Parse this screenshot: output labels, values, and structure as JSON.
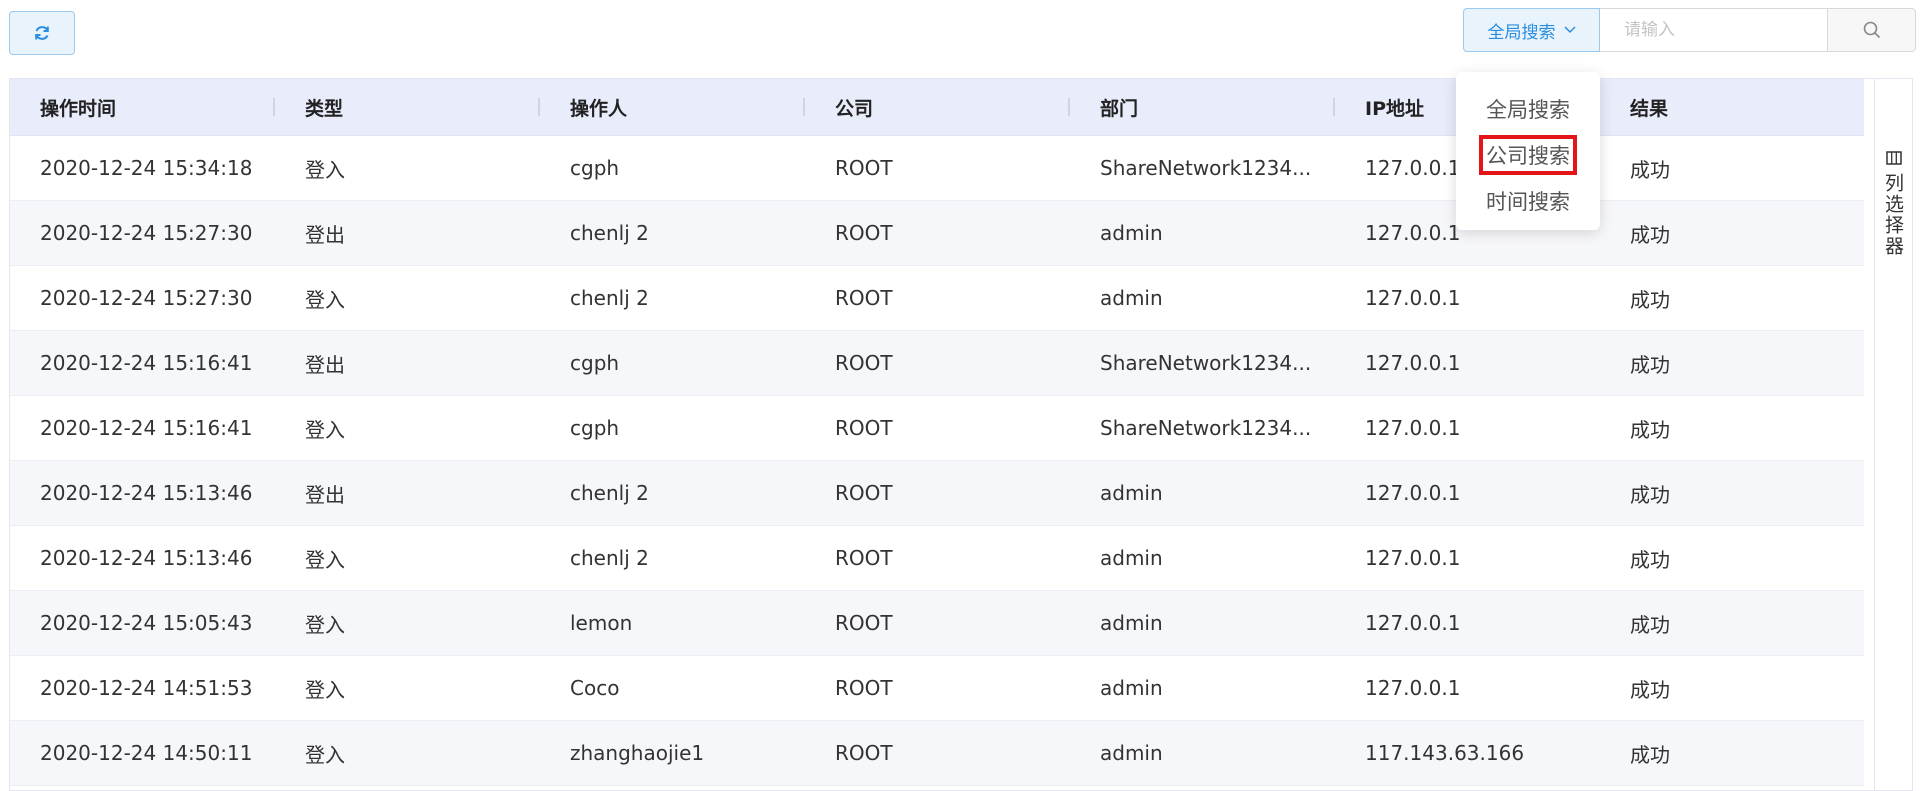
{
  "toolbar": {
    "scope_label": "全局搜索",
    "search_placeholder": "请输入"
  },
  "table": {
    "columns": [
      "操作时间",
      "类型",
      "操作人",
      "公司",
      "部门",
      "IP地址",
      "结果"
    ],
    "rows": [
      [
        "2020-12-24 15:34:18",
        "登入",
        "cgph",
        "ROOT",
        "ShareNetwork1234...",
        "127.0.0.1",
        "成功"
      ],
      [
        "2020-12-24 15:27:30",
        "登出",
        "chenlj 2",
        "ROOT",
        "admin",
        "127.0.0.1",
        "成功"
      ],
      [
        "2020-12-24 15:27:30",
        "登入",
        "chenlj 2",
        "ROOT",
        "admin",
        "127.0.0.1",
        "成功"
      ],
      [
        "2020-12-24 15:16:41",
        "登出",
        "cgph",
        "ROOT",
        "ShareNetwork1234...",
        "127.0.0.1",
        "成功"
      ],
      [
        "2020-12-24 15:16:41",
        "登入",
        "cgph",
        "ROOT",
        "ShareNetwork1234...",
        "127.0.0.1",
        "成功"
      ],
      [
        "2020-12-24 15:13:46",
        "登出",
        "chenlj 2",
        "ROOT",
        "admin",
        "127.0.0.1",
        "成功"
      ],
      [
        "2020-12-24 15:13:46",
        "登入",
        "chenlj 2",
        "ROOT",
        "admin",
        "127.0.0.1",
        "成功"
      ],
      [
        "2020-12-24 15:05:43",
        "登入",
        "lemon",
        "ROOT",
        "admin",
        "127.0.0.1",
        "成功"
      ],
      [
        "2020-12-24 14:51:53",
        "登入",
        "Coco",
        "ROOT",
        "admin",
        "127.0.0.1",
        "成功"
      ],
      [
        "2020-12-24 14:50:11",
        "登入",
        "zhanghaojie1",
        "ROOT",
        "admin",
        "117.143.63.166",
        "成功"
      ]
    ]
  },
  "column_selector": {
    "label": "列选择器"
  },
  "dropdown": {
    "items": [
      "全局搜索",
      "公司搜索",
      "时间搜索"
    ],
    "highlighted_index": 1
  },
  "colors": {
    "accent": "#2a8ee0",
    "header_bg": "#e9ecfb",
    "highlight": "#e4141b"
  },
  "icons": [
    "refresh-icon",
    "chevron-down-icon",
    "search-icon",
    "columns-icon"
  ]
}
